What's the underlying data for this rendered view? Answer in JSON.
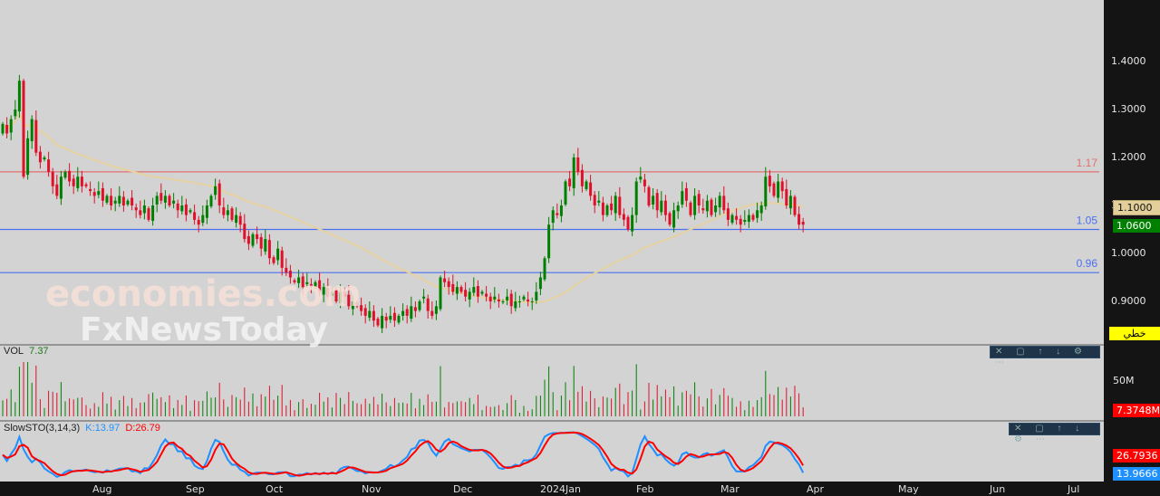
{
  "chart_data": {
    "type": "candlestick",
    "instrument_note": "daily candles, price axis right",
    "price_axis": {
      "ticks": [
        "1.4000",
        "1.3000",
        "1.2000",
        "1.1000",
        "1.0000",
        "0.9000"
      ],
      "range": [
        0.82,
        1.48
      ]
    },
    "x_ticks": [
      "Aug",
      "Sep",
      "Oct",
      "Nov",
      "Dec",
      "2024Jan",
      "Feb",
      "Mar",
      "Apr",
      "May",
      "Jun",
      "Jul"
    ],
    "close": [
      1.27,
      1.25,
      1.28,
      1.3,
      1.36,
      1.16,
      1.24,
      1.28,
      1.21,
      1.19,
      1.2,
      1.17,
      1.14,
      1.12,
      1.16,
      1.17,
      1.15,
      1.14,
      1.16,
      1.14,
      1.14,
      1.13,
      1.12,
      1.13,
      1.11,
      1.12,
      1.1,
      1.11,
      1.12,
      1.1,
      1.11,
      1.1,
      1.09,
      1.08,
      1.1,
      1.07,
      1.1,
      1.12,
      1.11,
      1.12,
      1.1,
      1.11,
      1.09,
      1.1,
      1.08,
      1.09,
      1.07,
      1.06,
      1.08,
      1.1,
      1.12,
      1.14,
      1.1,
      1.08,
      1.09,
      1.07,
      1.08,
      1.06,
      1.03,
      1.02,
      1.04,
      1.03,
      1.01,
      1.03,
      0.99,
      0.98,
      1.01,
      0.97,
      0.96,
      0.95,
      0.94,
      0.95,
      0.93,
      0.94,
      0.93,
      0.94,
      0.92,
      0.93,
      0.91,
      0.92,
      0.9,
      0.92,
      0.91,
      0.89,
      0.9,
      0.89,
      0.88,
      0.87,
      0.88,
      0.86,
      0.85,
      0.87,
      0.86,
      0.87,
      0.86,
      0.87,
      0.88,
      0.87,
      0.89,
      0.88,
      0.9,
      0.91,
      0.88,
      0.87,
      0.89,
      0.95,
      0.94,
      0.93,
      0.92,
      0.93,
      0.92,
      0.91,
      0.92,
      0.93,
      0.91,
      0.92,
      0.91,
      0.9,
      0.91,
      0.9,
      0.9,
      0.91,
      0.89,
      0.9,
      0.9,
      0.91,
      0.9,
      0.9,
      0.92,
      0.95,
      0.99,
      1.06,
      1.09,
      1.08,
      1.1,
      1.15,
      1.14,
      1.2,
      1.17,
      1.14,
      1.15,
      1.12,
      1.1,
      1.11,
      1.08,
      1.1,
      1.09,
      1.12,
      1.08,
      1.07,
      1.05,
      1.08,
      1.15,
      1.16,
      1.14,
      1.1,
      1.12,
      1.09,
      1.11,
      1.08,
      1.06,
      1.09,
      1.1,
      1.13,
      1.11,
      1.08,
      1.12,
      1.1,
      1.09,
      1.11,
      1.08,
      1.1,
      1.12,
      1.09,
      1.07,
      1.08,
      1.07,
      1.06,
      1.07,
      1.08,
      1.07,
      1.09,
      1.1,
      1.16,
      1.14,
      1.12,
      1.15,
      1.13,
      1.1,
      1.12,
      1.08,
      1.06,
      1.06
    ],
    "moving_average_color": "#e6d2a0",
    "horizontal_lines": [
      {
        "value": 1.17,
        "label": "1.17",
        "color": "#e07070"
      },
      {
        "value": 1.05,
        "label": "1.05",
        "color": "#4a70f0"
      },
      {
        "value": 0.96,
        "label": "0.96",
        "color": "#4a70f0"
      }
    ],
    "price_tags": [
      {
        "label": "1.1000",
        "color": "#e3cf9a"
      },
      {
        "label": "1.0600",
        "color": "#008000"
      }
    ],
    "up_color": "#008000",
    "down_color": "#e0102a"
  },
  "chart_type_button": "خطي",
  "watermark": {
    "line1": "economies.com",
    "line2": "FxNewsToday"
  },
  "volume": {
    "title": "VOL",
    "value": "7.37",
    "tick": "50M",
    "tag": "7.3748M"
  },
  "stochastic": {
    "title": "SlowSTO(3,14,3)",
    "k_label": "K:13.97",
    "d_label": "D:26.79",
    "d_tag": "26.7936",
    "k_tag": "13.9666",
    "k_color": "#1e90ff",
    "d_color": "#ff0000"
  },
  "pane_tools": "✕ ▢ ↑ ↓ ⚙ ⋯"
}
